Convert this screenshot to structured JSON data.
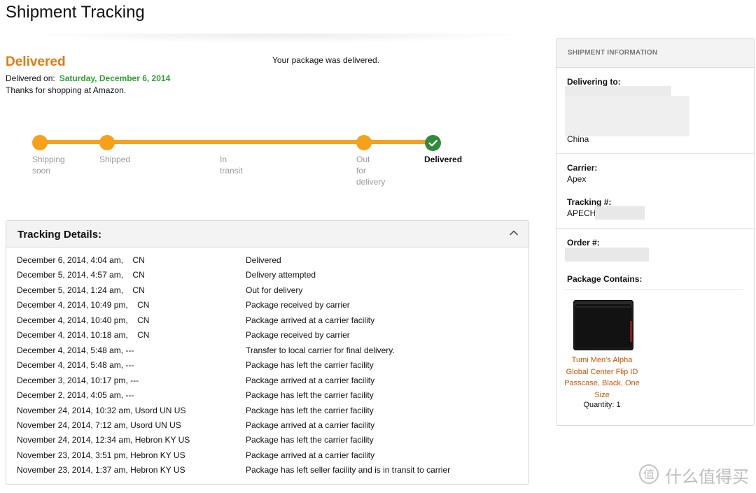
{
  "page": {
    "title": "Shipment Tracking"
  },
  "status": {
    "heading": "Delivered",
    "message": "Your package was delivered.",
    "delivered_on_label": "Delivered on:",
    "delivered_date": "Saturday, December 6, 2014",
    "thanks": "Thanks for shopping at Amazon."
  },
  "progress": {
    "completed_fraction": 1.0,
    "steps": [
      {
        "line1": "Shipping",
        "line2": "soon",
        "line3": "",
        "state": "done"
      },
      {
        "line1": "Shipped",
        "line2": "",
        "line3": "",
        "state": "done"
      },
      {
        "line1": "In",
        "line2": "transit",
        "line3": "",
        "state": "passed"
      },
      {
        "line1": "Out",
        "line2": "for",
        "line3": "delivery",
        "state": "done"
      },
      {
        "line1": "Delivered",
        "line2": "",
        "line3": "",
        "state": "current"
      }
    ]
  },
  "tracking": {
    "title": "Tracking Details:",
    "events": [
      {
        "time": "December 6, 2014, 4:04 am,    CN",
        "desc": "Delivered"
      },
      {
        "time": "December 5, 2014, 4:57 am,    CN",
        "desc": "Delivery attempted"
      },
      {
        "time": "December 5, 2014, 1:24 am,    CN",
        "desc": "Out for delivery"
      },
      {
        "time": "December 4, 2014, 10:49 pm,    CN",
        "desc": "Package received by carrier"
      },
      {
        "time": "December 4, 2014, 10:40 pm,    CN",
        "desc": "Package arrived at a carrier facility"
      },
      {
        "time": "December 4, 2014, 10:18 am,    CN",
        "desc": "Package received by carrier"
      },
      {
        "time": "December 4, 2014, 5:48 am, ---",
        "desc": "Transfer to local carrier for final delivery."
      },
      {
        "time": "December 4, 2014, 5:48 am, ---",
        "desc": "Package has left the carrier facility"
      },
      {
        "time": "December 3, 2014, 10:17 pm, ---",
        "desc": "Package arrived at a carrier facility"
      },
      {
        "time": "December 2, 2014, 4:05 am, ---",
        "desc": "Package has left the carrier facility"
      },
      {
        "time": "November 24, 2014, 10:32 am, Usord UN US",
        "desc": "Package has left the carrier facility"
      },
      {
        "time": "November 24, 2014, 7:12 am, Usord UN US",
        "desc": "Package arrived at a carrier facility"
      },
      {
        "time": "November 24, 2014, 12:34 am, Hebron KY US",
        "desc": "Package has left the carrier facility"
      },
      {
        "time": "November 23, 2014, 3:51 pm, Hebron KY US",
        "desc": "Package arrived at a carrier facility"
      },
      {
        "time": "November 23, 2014, 1:37 am, Hebron KY US",
        "desc": "Package has left seller facility and is in transit to carrier"
      }
    ]
  },
  "shipment_info": {
    "header": "SHIPMENT INFORMATION",
    "delivering_to_label": "Delivering to:",
    "country": "China",
    "carrier_label": "Carrier:",
    "carrier": "Apex",
    "tracking_label": "Tracking #:",
    "tracking_prefix": "APECHI",
    "order_label": "Order #:",
    "package_label": "Package Contains:",
    "product_title": "Tumi Men's Alpha Global Center Flip ID Passcase, Black, One Size",
    "quantity": "Quantity: 1"
  },
  "watermark": {
    "text": "什么值得买"
  },
  "colors": {
    "accent_orange": "#f7a01a",
    "status_orange": "#e47911",
    "delivered_green": "#2f8b3c",
    "date_green": "#2e9e2e",
    "link": "#c45500"
  }
}
